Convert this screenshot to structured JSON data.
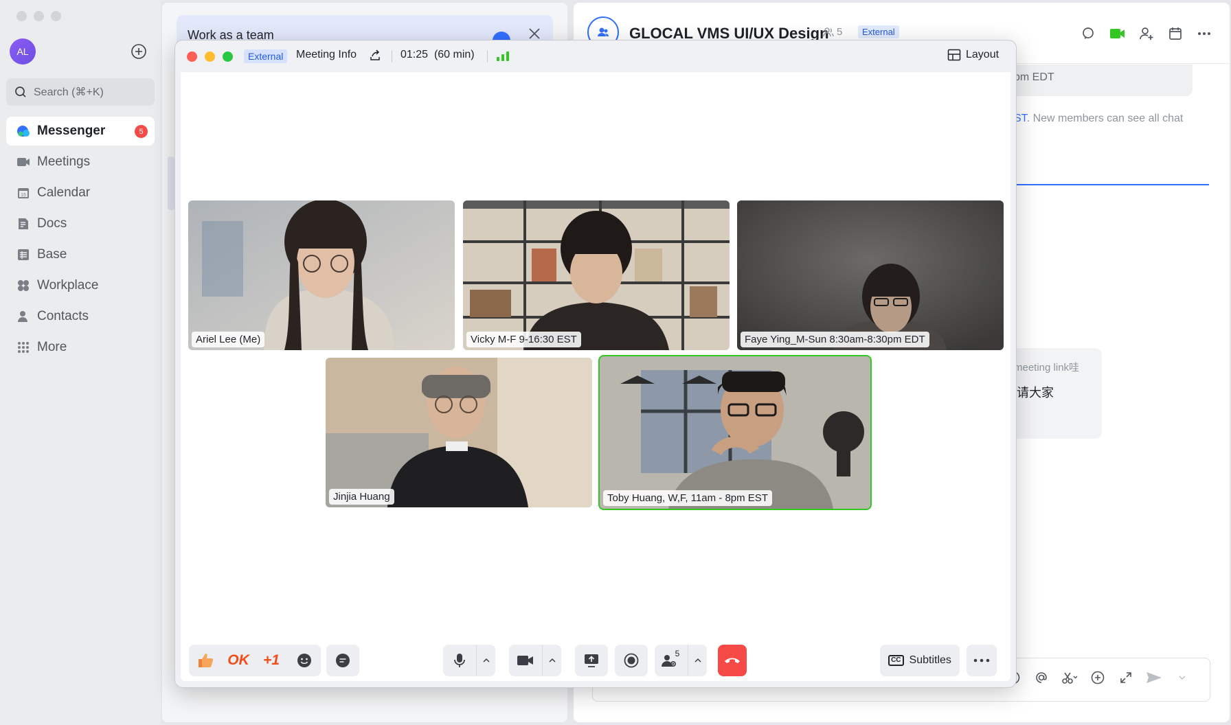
{
  "sidebar": {
    "avatar_initials": "AL",
    "search_placeholder": "Search (⌘+K)",
    "items": [
      {
        "label": "Messenger",
        "icon": "messenger-icon",
        "active": true,
        "badge": "5"
      },
      {
        "label": "Meetings",
        "icon": "video-camera-icon"
      },
      {
        "label": "Calendar",
        "icon": "calendar-icon"
      },
      {
        "label": "Docs",
        "icon": "docs-icon"
      },
      {
        "label": "Base",
        "icon": "base-table-icon"
      },
      {
        "label": "Workplace",
        "icon": "workplace-grid-icon"
      },
      {
        "label": "Contacts",
        "icon": "contacts-icon"
      },
      {
        "label": "More",
        "icon": "more-dots-grid-icon"
      }
    ]
  },
  "middle": {
    "banner_title": "Work as a team"
  },
  "chat": {
    "title": "GLOCAL VMS UI/UX Design",
    "member_count": "5",
    "tag": "External",
    "system_text": "pm EDT",
    "notice_link": "ST",
    "notice_text": ". New members can see all chat",
    "message_line1": "meeting link哇",
    "message_line2": "请大家"
  },
  "meeting": {
    "tag": "External",
    "info_label": "Meeting Info",
    "time": "01:25",
    "duration": "(60 min)",
    "layout_label": "Layout",
    "participants": [
      {
        "name": "Ariel Lee (Me)",
        "speaking": false
      },
      {
        "name": "Vicky M-F 9-16:30 EST",
        "speaking": false
      },
      {
        "name": "Faye Ying_M-Sun 8:30am-8:30pm EDT",
        "speaking": false
      },
      {
        "name": "Jinjia Huang",
        "speaking": false
      },
      {
        "name": "Toby Huang, W,F, 11am - 8pm EST",
        "speaking": true
      }
    ],
    "reactions": {
      "ok": "OK",
      "plus_one": "+1"
    },
    "participant_count": "5",
    "subtitles_label": "Subtitles",
    "colors": {
      "accent": "#3370ff",
      "end_call": "#f54a45",
      "speaking": "#34c724"
    }
  }
}
